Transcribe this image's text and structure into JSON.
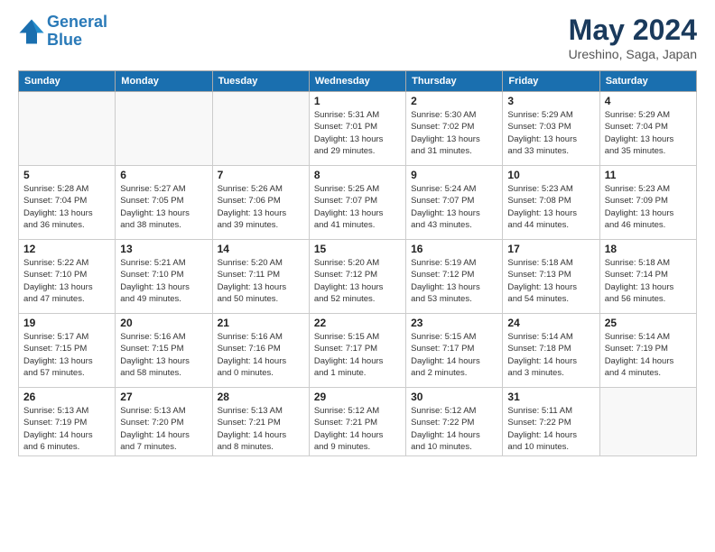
{
  "header": {
    "logo_line1": "General",
    "logo_line2": "Blue",
    "month_year": "May 2024",
    "location": "Ureshino, Saga, Japan"
  },
  "weekdays": [
    "Sunday",
    "Monday",
    "Tuesday",
    "Wednesday",
    "Thursday",
    "Friday",
    "Saturday"
  ],
  "weeks": [
    [
      {
        "day": "",
        "info": ""
      },
      {
        "day": "",
        "info": ""
      },
      {
        "day": "",
        "info": ""
      },
      {
        "day": "1",
        "info": "Sunrise: 5:31 AM\nSunset: 7:01 PM\nDaylight: 13 hours\nand 29 minutes."
      },
      {
        "day": "2",
        "info": "Sunrise: 5:30 AM\nSunset: 7:02 PM\nDaylight: 13 hours\nand 31 minutes."
      },
      {
        "day": "3",
        "info": "Sunrise: 5:29 AM\nSunset: 7:03 PM\nDaylight: 13 hours\nand 33 minutes."
      },
      {
        "day": "4",
        "info": "Sunrise: 5:29 AM\nSunset: 7:04 PM\nDaylight: 13 hours\nand 35 minutes."
      }
    ],
    [
      {
        "day": "5",
        "info": "Sunrise: 5:28 AM\nSunset: 7:04 PM\nDaylight: 13 hours\nand 36 minutes."
      },
      {
        "day": "6",
        "info": "Sunrise: 5:27 AM\nSunset: 7:05 PM\nDaylight: 13 hours\nand 38 minutes."
      },
      {
        "day": "7",
        "info": "Sunrise: 5:26 AM\nSunset: 7:06 PM\nDaylight: 13 hours\nand 39 minutes."
      },
      {
        "day": "8",
        "info": "Sunrise: 5:25 AM\nSunset: 7:07 PM\nDaylight: 13 hours\nand 41 minutes."
      },
      {
        "day": "9",
        "info": "Sunrise: 5:24 AM\nSunset: 7:07 PM\nDaylight: 13 hours\nand 43 minutes."
      },
      {
        "day": "10",
        "info": "Sunrise: 5:23 AM\nSunset: 7:08 PM\nDaylight: 13 hours\nand 44 minutes."
      },
      {
        "day": "11",
        "info": "Sunrise: 5:23 AM\nSunset: 7:09 PM\nDaylight: 13 hours\nand 46 minutes."
      }
    ],
    [
      {
        "day": "12",
        "info": "Sunrise: 5:22 AM\nSunset: 7:10 PM\nDaylight: 13 hours\nand 47 minutes."
      },
      {
        "day": "13",
        "info": "Sunrise: 5:21 AM\nSunset: 7:10 PM\nDaylight: 13 hours\nand 49 minutes."
      },
      {
        "day": "14",
        "info": "Sunrise: 5:20 AM\nSunset: 7:11 PM\nDaylight: 13 hours\nand 50 minutes."
      },
      {
        "day": "15",
        "info": "Sunrise: 5:20 AM\nSunset: 7:12 PM\nDaylight: 13 hours\nand 52 minutes."
      },
      {
        "day": "16",
        "info": "Sunrise: 5:19 AM\nSunset: 7:12 PM\nDaylight: 13 hours\nand 53 minutes."
      },
      {
        "day": "17",
        "info": "Sunrise: 5:18 AM\nSunset: 7:13 PM\nDaylight: 13 hours\nand 54 minutes."
      },
      {
        "day": "18",
        "info": "Sunrise: 5:18 AM\nSunset: 7:14 PM\nDaylight: 13 hours\nand 56 minutes."
      }
    ],
    [
      {
        "day": "19",
        "info": "Sunrise: 5:17 AM\nSunset: 7:15 PM\nDaylight: 13 hours\nand 57 minutes."
      },
      {
        "day": "20",
        "info": "Sunrise: 5:16 AM\nSunset: 7:15 PM\nDaylight: 13 hours\nand 58 minutes."
      },
      {
        "day": "21",
        "info": "Sunrise: 5:16 AM\nSunset: 7:16 PM\nDaylight: 14 hours\nand 0 minutes."
      },
      {
        "day": "22",
        "info": "Sunrise: 5:15 AM\nSunset: 7:17 PM\nDaylight: 14 hours\nand 1 minute."
      },
      {
        "day": "23",
        "info": "Sunrise: 5:15 AM\nSunset: 7:17 PM\nDaylight: 14 hours\nand 2 minutes."
      },
      {
        "day": "24",
        "info": "Sunrise: 5:14 AM\nSunset: 7:18 PM\nDaylight: 14 hours\nand 3 minutes."
      },
      {
        "day": "25",
        "info": "Sunrise: 5:14 AM\nSunset: 7:19 PM\nDaylight: 14 hours\nand 4 minutes."
      }
    ],
    [
      {
        "day": "26",
        "info": "Sunrise: 5:13 AM\nSunset: 7:19 PM\nDaylight: 14 hours\nand 6 minutes."
      },
      {
        "day": "27",
        "info": "Sunrise: 5:13 AM\nSunset: 7:20 PM\nDaylight: 14 hours\nand 7 minutes."
      },
      {
        "day": "28",
        "info": "Sunrise: 5:13 AM\nSunset: 7:21 PM\nDaylight: 14 hours\nand 8 minutes."
      },
      {
        "day": "29",
        "info": "Sunrise: 5:12 AM\nSunset: 7:21 PM\nDaylight: 14 hours\nand 9 minutes."
      },
      {
        "day": "30",
        "info": "Sunrise: 5:12 AM\nSunset: 7:22 PM\nDaylight: 14 hours\nand 10 minutes."
      },
      {
        "day": "31",
        "info": "Sunrise: 5:11 AM\nSunset: 7:22 PM\nDaylight: 14 hours\nand 10 minutes."
      },
      {
        "day": "",
        "info": ""
      }
    ]
  ]
}
